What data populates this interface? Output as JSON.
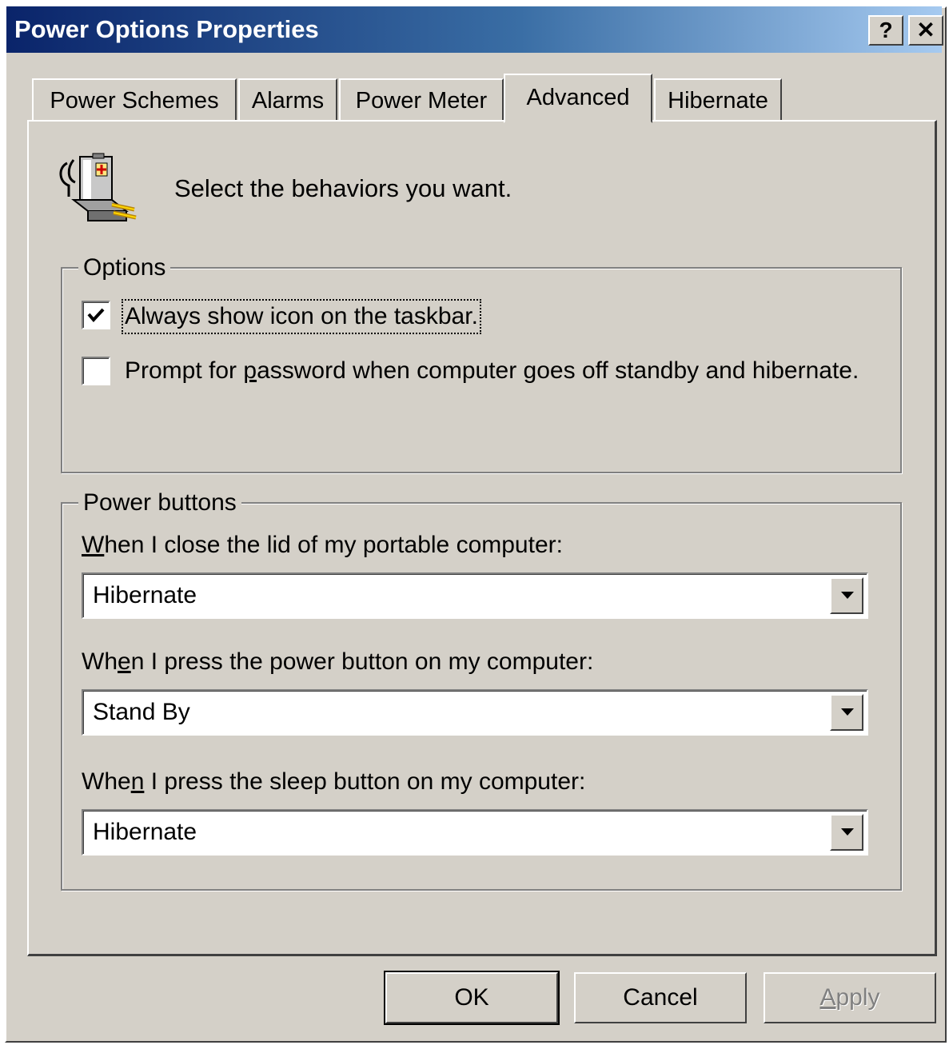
{
  "window": {
    "title": "Power Options Properties",
    "help_label": "?",
    "close_label": "✕"
  },
  "tabs": [
    {
      "label": "Power Schemes",
      "active": false
    },
    {
      "label": "Alarms",
      "active": false
    },
    {
      "label": "Power Meter",
      "active": false
    },
    {
      "label": "Advanced",
      "active": true
    },
    {
      "label": "Hibernate",
      "active": false
    }
  ],
  "header": {
    "icon": "power-plug-battery-icon",
    "text": "Select the behaviors you want."
  },
  "options_group": {
    "title": "Options",
    "always_show_icon": {
      "label": "Always show icon on the taskbar.",
      "checked": true
    },
    "prompt_password": {
      "label_before": "Prompt for ",
      "label_underlined": "p",
      "label_after": "assword when computer goes off standby and hibernate.",
      "checked": false
    }
  },
  "power_buttons_group": {
    "title": "Power buttons",
    "lid": {
      "label_underlined": "W",
      "label_after": "hen I close the lid of my portable computer:",
      "value": "Hibernate"
    },
    "power_button": {
      "label_before": "Wh",
      "label_underlined": "e",
      "label_after": "n I press the power button on my computer:",
      "value": "Stand By"
    },
    "sleep_button": {
      "label_before": "Whe",
      "label_underlined": "n",
      "label_after": " I press the sleep button on my computer:",
      "value": "Hibernate"
    }
  },
  "buttons": {
    "ok": "OK",
    "cancel": "Cancel",
    "apply_underlined": "A",
    "apply_rest": "pply"
  },
  "colors": {
    "face": "#d4d0c8",
    "titlebar_start": "#0a246a",
    "titlebar_end": "#a6caf0"
  }
}
